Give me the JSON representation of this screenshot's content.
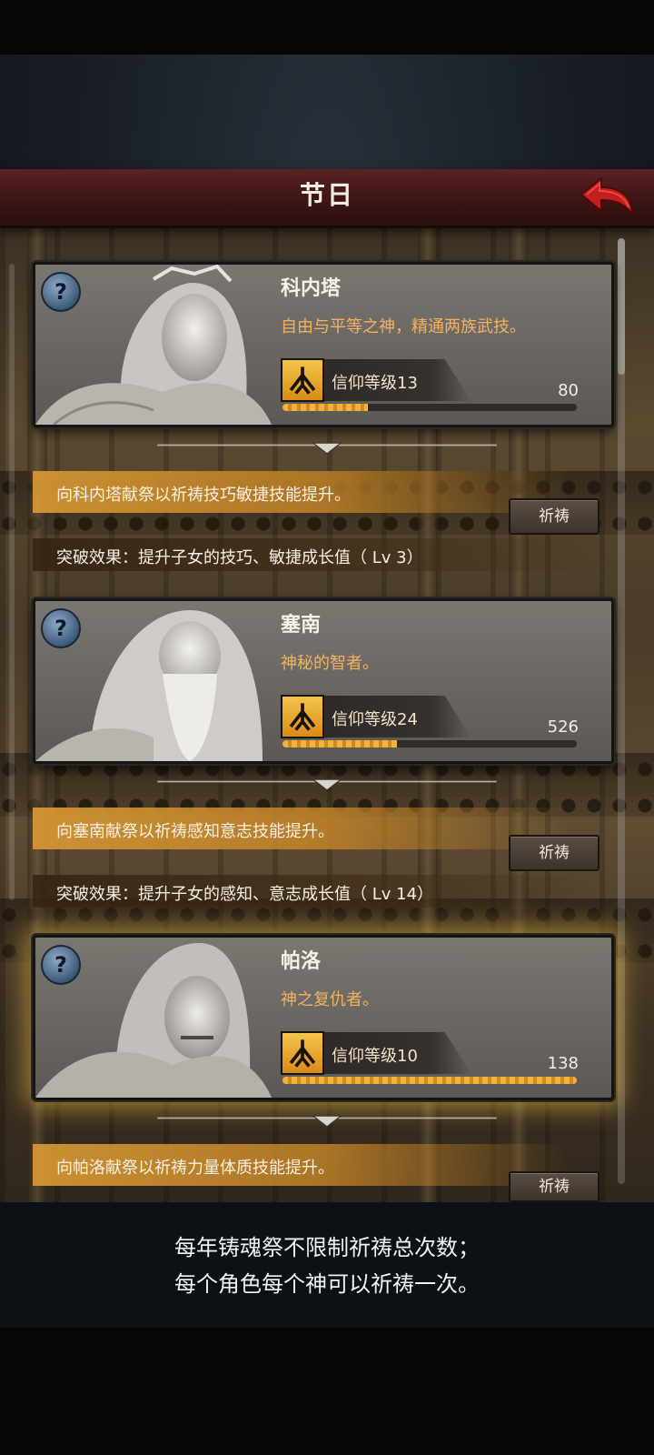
{
  "header": {
    "title": "节日"
  },
  "gods": [
    {
      "name": "科内塔",
      "description": "自由与平等之神，精通两族武技。",
      "faith_label": "信仰等级",
      "faith_level": "13",
      "points": "80",
      "progress_fraction": 0.29,
      "prayer_text": "向科内塔献祭以祈祷技巧敏捷技能提升。",
      "breakthrough_text": "突破效果：提升子女的技巧、敏捷成长值（ Lv 3）",
      "pray_label": "祈祷"
    },
    {
      "name": "塞南",
      "description": "神秘的智者。",
      "faith_label": "信仰等级",
      "faith_level": "24",
      "points": "526",
      "progress_fraction": 0.39,
      "prayer_text": "向塞南献祭以祈祷感知意志技能提升。",
      "breakthrough_text": "突破效果：提升子女的感知、意志成长值（ Lv 14）",
      "pray_label": "祈祷"
    },
    {
      "name": "帕洛",
      "description": "神之复仇者。",
      "faith_label": "信仰等级",
      "faith_level": "10",
      "points": "138",
      "progress_fraction": 1.0,
      "prayer_text": "向帕洛献祭以祈祷力量体质技能提升。",
      "pray_label": "祈祷"
    }
  ],
  "footer": {
    "line1": "每年铸魂祭不限制祈祷总次数；",
    "line2": "每个角色每个神可以祈祷一次。"
  },
  "colors": {
    "header": "#3c1516",
    "accent_orange": "#f3b35e",
    "band_orange": "#d49634",
    "back_arrow": "#c0201e"
  }
}
